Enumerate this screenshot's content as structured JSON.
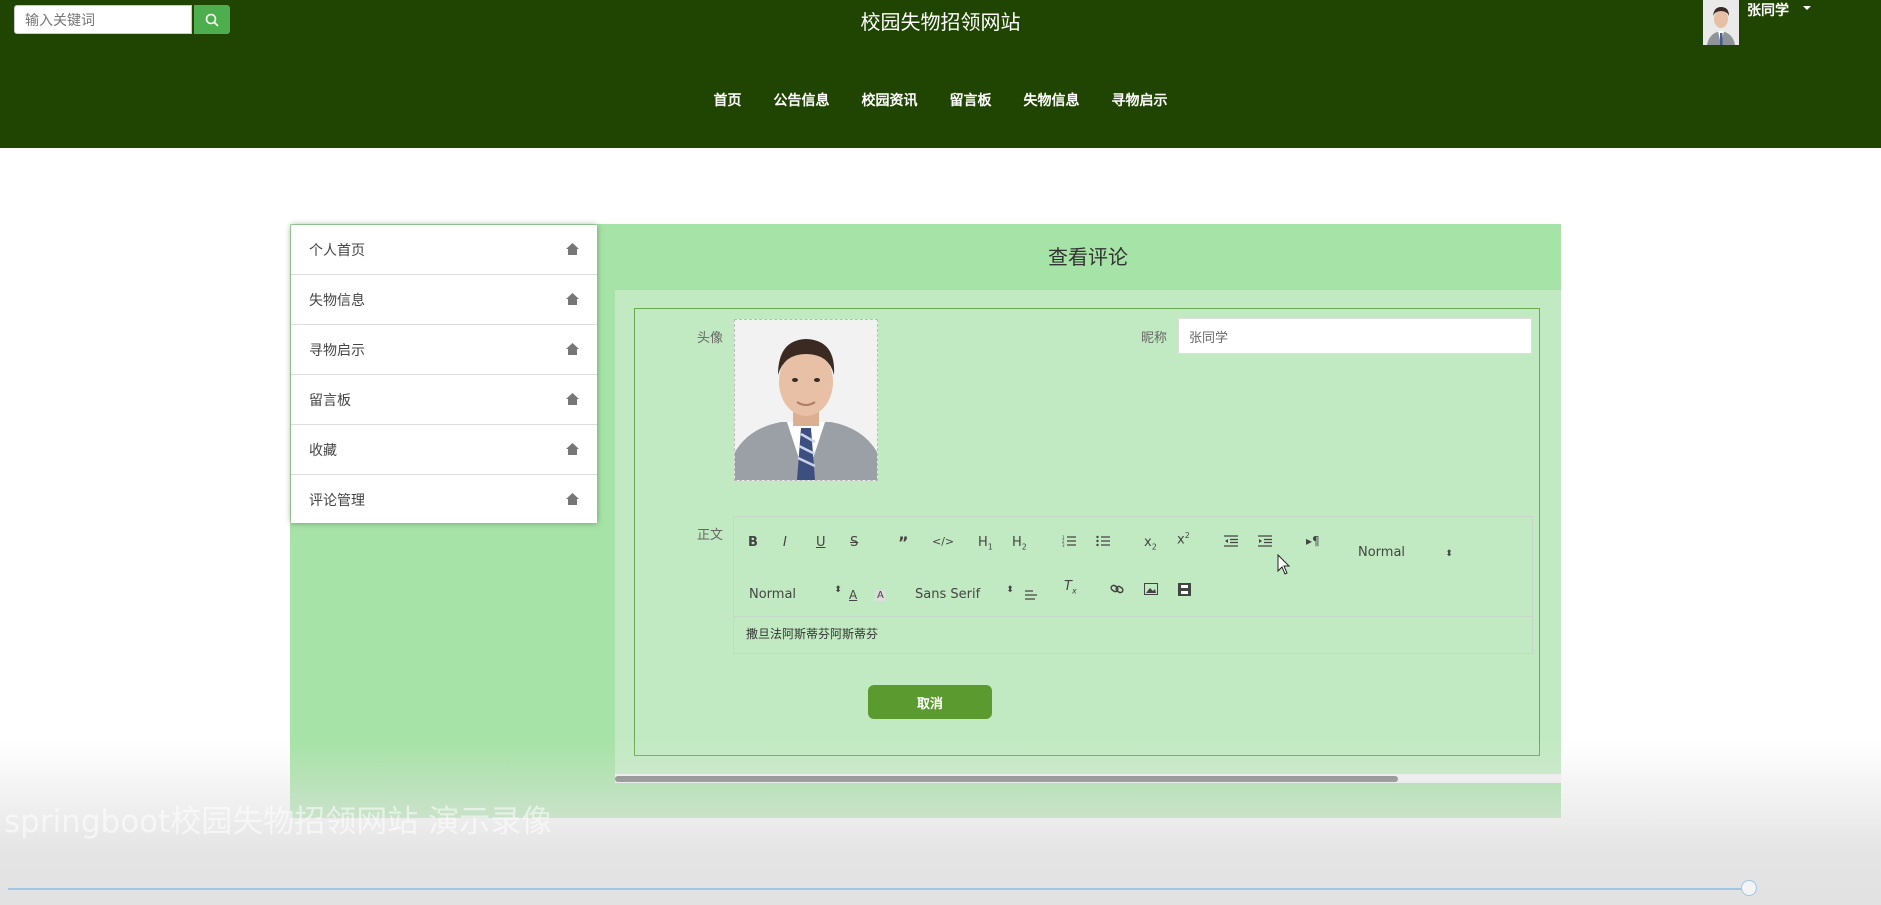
{
  "header": {
    "site_title": "校园失物招领网站",
    "search_placeholder": "输入关键词",
    "user_name": "张同学",
    "nav": [
      "首页",
      "公告信息",
      "校园资讯",
      "留言板",
      "失物信息",
      "寻物启示"
    ]
  },
  "sidebar": {
    "items": [
      "个人首页",
      "失物信息",
      "寻物启示",
      "留言板",
      "收藏",
      "评论管理"
    ]
  },
  "content": {
    "title": "查看评论",
    "avatar_label": "头像",
    "nickname_label": "昵称",
    "nickname_value": "张同学",
    "body_label": "正文",
    "editor": {
      "header_select": "Normal",
      "size_select": "Normal",
      "font_select": "Sans Serif",
      "text": "撒旦法阿斯蒂芬阿斯蒂芬"
    },
    "cancel_label": "取消"
  },
  "overlay": {
    "watermark": "springboot校园失物招领网站 演示录像"
  },
  "colors": {
    "header_bg": "#204402",
    "panel_bg": "#a6e3a6",
    "form_bg": "#c2eac2",
    "button": "#5b9a2e",
    "search_button": "#4cae4c"
  }
}
